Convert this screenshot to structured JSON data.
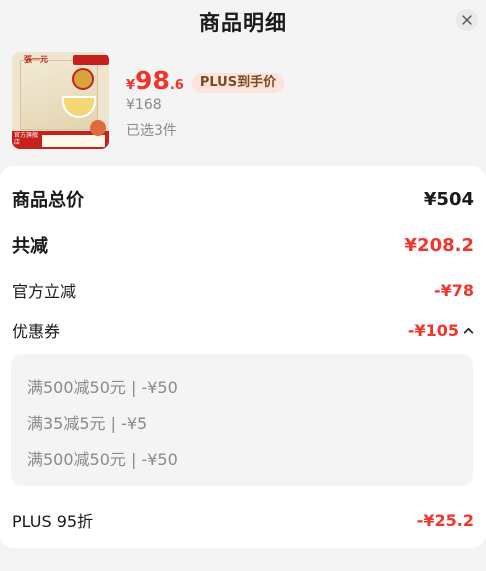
{
  "header": {
    "title": "商品明细",
    "close_icon": "close-icon"
  },
  "product": {
    "price_symbol": "¥",
    "price_int": "98",
    "price_dec": ".6",
    "plus_tag": "PLUS到手价",
    "original_price": "¥168",
    "selected_count": "已选3件",
    "thumbnail": {
      "brand": "張一元",
      "footer_label": "官方旗舰店"
    }
  },
  "summary": {
    "total_label": "商品总价",
    "total_value": "¥504",
    "discount_label": "共减",
    "discount_value": "¥208.2",
    "official_label": "官方立减",
    "official_value": "-¥78",
    "coupon_label": "优惠券",
    "coupon_value": "-¥105",
    "coupons": [
      "满500减50元 | -¥50",
      "满35减5元 | -¥5",
      "满500减50元 | -¥50"
    ],
    "plus_label": "PLUS 95折",
    "plus_value": "-¥25.2"
  },
  "colors": {
    "accent_red": "#f2352b",
    "plus_tag_bg": "#fde3d9",
    "background": "#f4f4f4"
  }
}
